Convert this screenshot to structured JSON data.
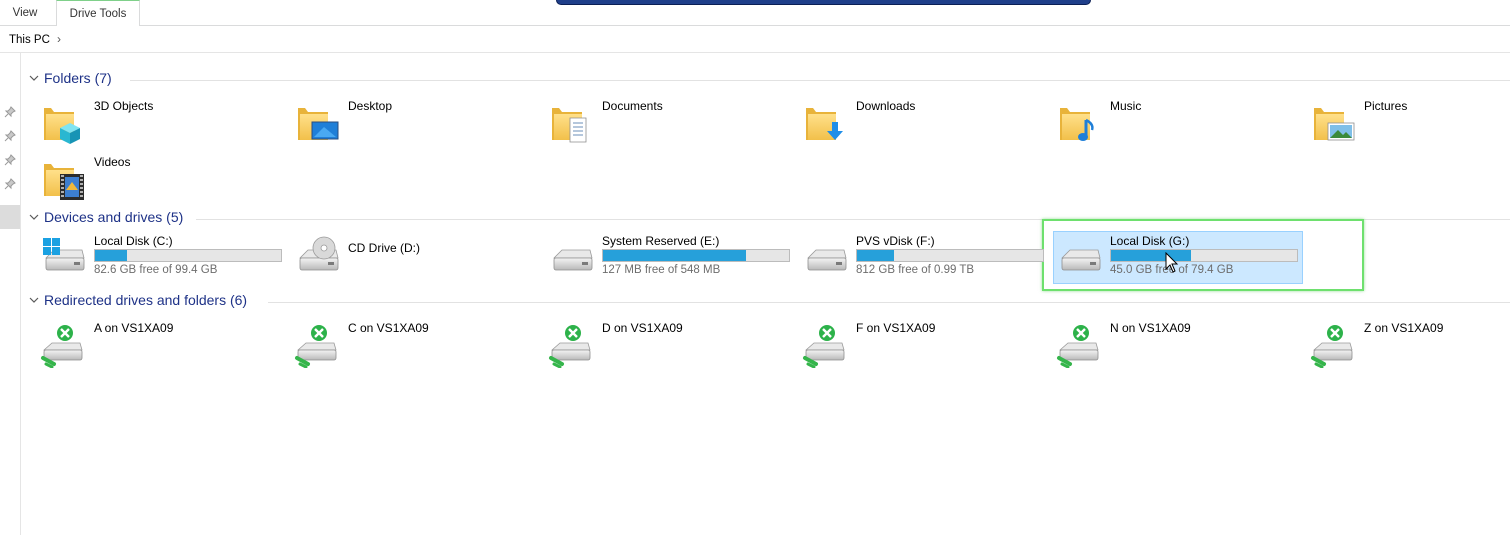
{
  "ribbon": {
    "tabs": [
      {
        "label": "View"
      },
      {
        "label": "Drive Tools"
      }
    ]
  },
  "address": {
    "path": "This PC",
    "separator": "›"
  },
  "groups": {
    "folders": {
      "title": "Folders (7)",
      "items": [
        {
          "label": "3D Objects",
          "icon": "folder-3d-objects-icon"
        },
        {
          "label": "Desktop",
          "icon": "folder-desktop-icon"
        },
        {
          "label": "Documents",
          "icon": "folder-documents-icon"
        },
        {
          "label": "Downloads",
          "icon": "folder-downloads-icon"
        },
        {
          "label": "Music",
          "icon": "folder-music-icon"
        },
        {
          "label": "Pictures",
          "icon": "folder-pictures-icon"
        },
        {
          "label": "Videos",
          "icon": "folder-videos-icon"
        }
      ]
    },
    "drives": {
      "title": "Devices and drives (5)",
      "items": [
        {
          "label": "Local Disk (C:)",
          "free_text": "82.6 GB free of 99.4 GB",
          "used_fraction": 0.17,
          "icon": "windows-drive-icon"
        },
        {
          "label": "CD Drive (D:)",
          "free_text": "",
          "used_fraction": null,
          "icon": "cd-drive-icon"
        },
        {
          "label": "System Reserved (E:)",
          "free_text": "127 MB free of 548 MB",
          "used_fraction": 0.77,
          "icon": "hard-drive-icon"
        },
        {
          "label": "PVS vDisk (F:)",
          "free_text": "812 GB free of 0.99 TB",
          "used_fraction": 0.2,
          "icon": "hard-drive-icon"
        },
        {
          "label": "Local Disk (G:)",
          "free_text": "45.0 GB free of 79.4 GB",
          "used_fraction": 0.43,
          "icon": "hard-drive-icon",
          "selected": true
        }
      ]
    },
    "redirected": {
      "title": "Redirected drives and folders (6)",
      "items": [
        {
          "label": "A on VS1XA09",
          "icon": "network-drive-icon"
        },
        {
          "label": "C on VS1XA09",
          "icon": "network-drive-icon"
        },
        {
          "label": "D on VS1XA09",
          "icon": "network-drive-icon"
        },
        {
          "label": "F on VS1XA09",
          "icon": "network-drive-icon"
        },
        {
          "label": "N on VS1XA09",
          "icon": "network-drive-icon"
        },
        {
          "label": "Z on VS1XA09",
          "icon": "network-drive-icon"
        }
      ]
    }
  },
  "colors": {
    "accent_blue": "#1e3287",
    "bar_fill": "#26a0da",
    "selection": "#cce8ff",
    "highlight_green": "#6ee06e"
  }
}
